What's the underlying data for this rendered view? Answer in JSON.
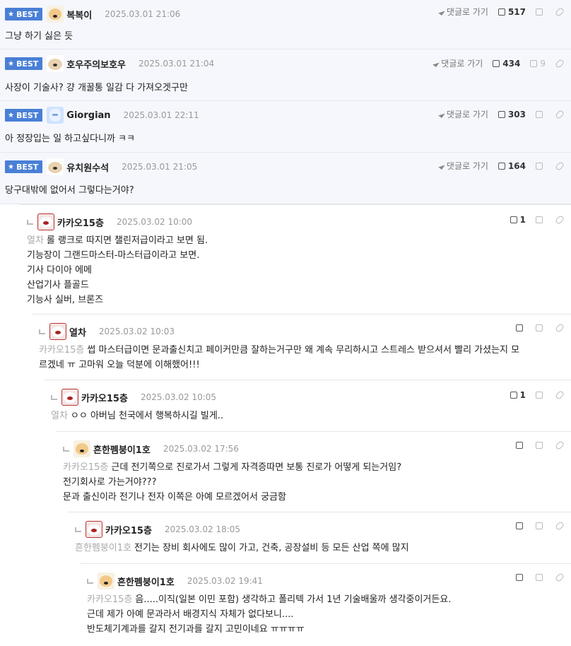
{
  "best_comments": [
    {
      "badge": "BEST",
      "nick": "복복이",
      "date": "2025.03.01 21:06",
      "text": "그냥 하기 싫은 듯",
      "goto": "댓글로 가기",
      "likes": "517",
      "dislikes": ""
    },
    {
      "badge": "BEST",
      "nick": "호우주의보호우",
      "date": "2025.03.01 21:04",
      "text": "사장이 기술사? 걍 개꿀통 일감 다 가져오겟구만",
      "goto": "댓글로 가기",
      "likes": "434",
      "dislikes": "9"
    },
    {
      "badge": "BEST",
      "nick": "Giorgian",
      "date": "2025.03.01 22:11",
      "text": "아 정장입는 일 하고싶다니까 ㅋㅋ",
      "goto": "댓글로 가기",
      "likes": "303",
      "dislikes": ""
    },
    {
      "badge": "BEST",
      "nick": "유치원수석",
      "date": "2025.03.01 21:05",
      "text": "당구대밖에 없어서 그렇다는거야?",
      "goto": "댓글로 가기",
      "likes": "164",
      "dislikes": ""
    }
  ],
  "replies": [
    {
      "nick": "카카오15층",
      "date": "2025.03.02 10:00",
      "mention": "열차",
      "lines": [
        "롤 랭크로 따지면 챌린저급이라고 보면 됨.",
        "기능장이 그랜드마스터-마스터급이라고 보면.",
        "기사 다이아 에메",
        "산업기사 플골드",
        "기능사 실버, 브론즈"
      ],
      "likes": "1"
    },
    {
      "nick": "열차",
      "date": "2025.03.02 10:03",
      "mention": "카카오15층",
      "lines": [
        "썹 마스터급이면 문과출신치고 페이커만큼 잘하는거구만 왜 계속 무리하시고 스트레스 받으셔서 빨리 가셨는지 모",
        "르겠네 ㅠ 고마워 오늘 덕분에 이해했어!!!"
      ],
      "likes": ""
    },
    {
      "nick": "카카오15층",
      "date": "2025.03.02 10:05",
      "mention": "열차",
      "lines": [
        "ㅇㅇ 아버님 천국에서 행복하시길 빌게.."
      ],
      "likes": "1"
    },
    {
      "nick": "흔한펨붕이1호",
      "date": "2025.03.02 17:56",
      "mention": "카카오15층",
      "lines": [
        "근데 전기쪽으로 진로가서 그렇게 자격증따면 보통 진로가 어떻게 되는거임?",
        "전기회사로 가는거야???",
        "문과 출신이라 전기나 전자 이쪽은 아예 모르겠어서 궁금함"
      ],
      "likes": ""
    },
    {
      "nick": "카카오15층",
      "date": "2025.03.02 18:05",
      "mention": "흔한펨붕이1호",
      "lines": [
        "전기는 장비 회사에도 많이 가고, 건축, 공장설비 등 모든 산업 쪽에 많지"
      ],
      "likes": ""
    },
    {
      "nick": "흔한펨붕이1호",
      "date": "2025.03.02 19:41",
      "mention": "카카오15층",
      "lines": [
        "음.....이직(일본 이민 포함) 생각하고 폴리텍 가서 1년 기술배울까 생각중이거든요.",
        "근데 제가 아예 문과라서 배경지식 자체가 없다보니....",
        "반도체기계과를 갈지 전기과를 갈지 고민이네요 ㅠㅠㅠㅠ"
      ],
      "likes": ""
    }
  ]
}
